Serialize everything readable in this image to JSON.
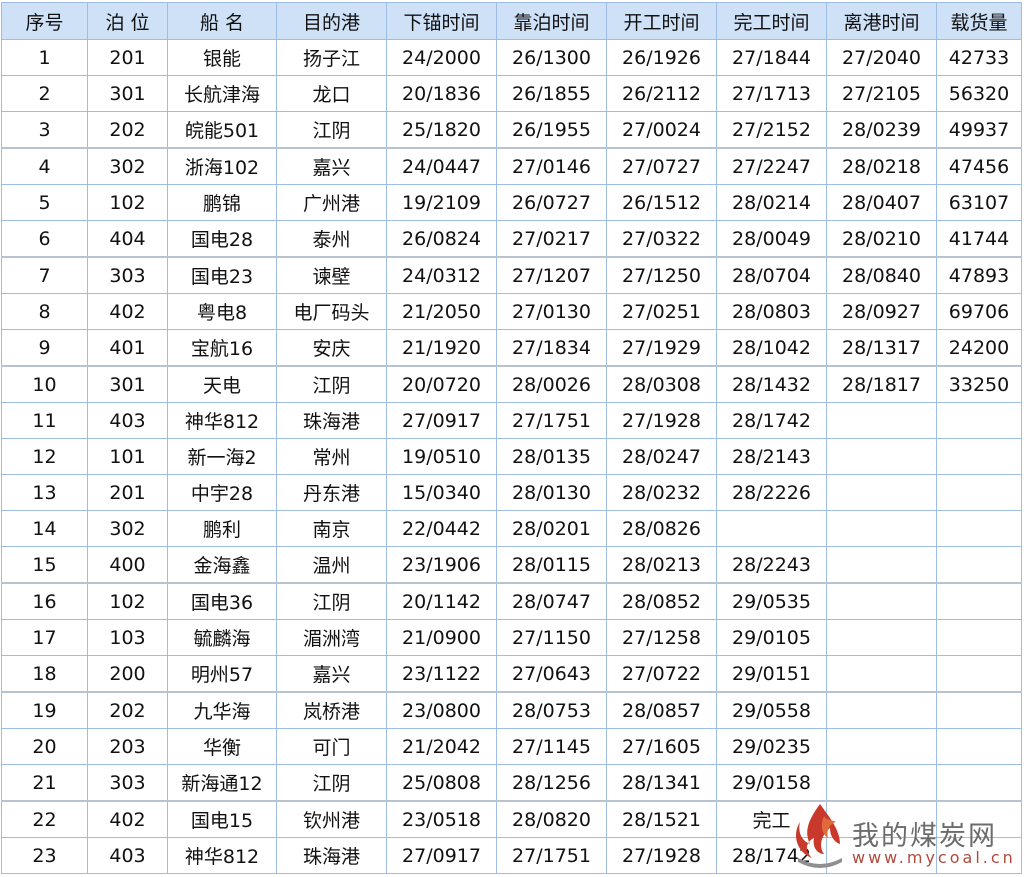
{
  "table": {
    "headers": [
      "序号",
      "泊 位",
      "船 名",
      "目的港",
      "下锚时间",
      "靠泊时间",
      "开工时间",
      "完工时间",
      "离港时间",
      "载货量"
    ],
    "rows": [
      [
        "1",
        "201",
        "银能",
        "扬子江",
        "24/2000",
        "26/1300",
        "26/1926",
        "27/1844",
        "27/2040",
        "42733"
      ],
      [
        "2",
        "301",
        "长航津海",
        "龙口",
        "20/1836",
        "26/1855",
        "26/2112",
        "27/1713",
        "27/2105",
        "56320"
      ],
      [
        "3",
        "202",
        "皖能501",
        "江阴",
        "25/1820",
        "26/1955",
        "27/0024",
        "27/2152",
        "28/0239",
        "49937"
      ],
      [
        "4",
        "302",
        "浙海102",
        "嘉兴",
        "24/0447",
        "27/0146",
        "27/0727",
        "27/2247",
        "28/0218",
        "47456"
      ],
      [
        "5",
        "102",
        "鹏锦",
        "广州港",
        "19/2109",
        "26/0727",
        "26/1512",
        "28/0214",
        "28/0407",
        "63107"
      ],
      [
        "6",
        "404",
        "国电28",
        "泰州",
        "26/0824",
        "27/0217",
        "27/0322",
        "28/0049",
        "28/0210",
        "41744"
      ],
      [
        "7",
        "303",
        "国电23",
        "谏壁",
        "24/0312",
        "27/1207",
        "27/1250",
        "28/0704",
        "28/0840",
        "47893"
      ],
      [
        "8",
        "402",
        "粤电8",
        "电厂码头",
        "21/2050",
        "27/0130",
        "27/0251",
        "28/0803",
        "28/0927",
        "69706"
      ],
      [
        "9",
        "401",
        "宝航16",
        "安庆",
        "21/1920",
        "27/1834",
        "27/1929",
        "28/1042",
        "28/1317",
        "24200"
      ],
      [
        "10",
        "301",
        "天电",
        "江阴",
        "20/0720",
        "28/0026",
        "28/0308",
        "28/1432",
        "28/1817",
        "33250"
      ],
      [
        "11",
        "403",
        "神华812",
        "珠海港",
        "27/0917",
        "27/1751",
        "27/1928",
        "28/1742",
        "",
        ""
      ],
      [
        "12",
        "101",
        "新一海2",
        "常州",
        "19/0510",
        "28/0135",
        "28/0247",
        "28/2143",
        "",
        ""
      ],
      [
        "13",
        "201",
        "中宇28",
        "丹东港",
        "15/0340",
        "28/0130",
        "28/0232",
        "28/2226",
        "",
        ""
      ],
      [
        "14",
        "302",
        "鹏利",
        "南京",
        "22/0442",
        "28/0201",
        "28/0826",
        "",
        "",
        ""
      ],
      [
        "15",
        "400",
        "金海鑫",
        "温州",
        "23/1906",
        "28/0115",
        "28/0213",
        "28/2243",
        "",
        ""
      ],
      [
        "16",
        "102",
        "国电36",
        "江阴",
        "20/1142",
        "28/0747",
        "28/0852",
        "29/0535",
        "",
        ""
      ],
      [
        "17",
        "103",
        "毓麟海",
        "湄洲湾",
        "21/0900",
        "27/1150",
        "27/1258",
        "29/0105",
        "",
        ""
      ],
      [
        "18",
        "200",
        "明州57",
        "嘉兴",
        "23/1122",
        "27/0643",
        "27/0722",
        "29/0151",
        "",
        ""
      ],
      [
        "19",
        "202",
        "九华海",
        "岚桥港",
        "23/0800",
        "28/0753",
        "28/0857",
        "29/0558",
        "",
        ""
      ],
      [
        "20",
        "203",
        "华衡",
        "可门",
        "21/2042",
        "27/1145",
        "27/1605",
        "29/0235",
        "",
        ""
      ],
      [
        "21",
        "303",
        "新海通12",
        "江阴",
        "25/0808",
        "28/1256",
        "28/1341",
        "29/0158",
        "",
        ""
      ],
      [
        "22",
        "402",
        "国电15",
        "钦州港",
        "23/0518",
        "28/0820",
        "28/1521",
        "完工",
        "",
        ""
      ],
      [
        "23",
        "403",
        "神华812",
        "珠海港",
        "27/0917",
        "27/1751",
        "27/1928",
        "28/1742",
        "",
        ""
      ]
    ]
  },
  "watermark": {
    "name": "我的煤炭网",
    "url": "www.mycoal.cn",
    "logo_colors": [
      "#c9392b",
      "#e06a3a",
      "#8f8f8f"
    ]
  }
}
